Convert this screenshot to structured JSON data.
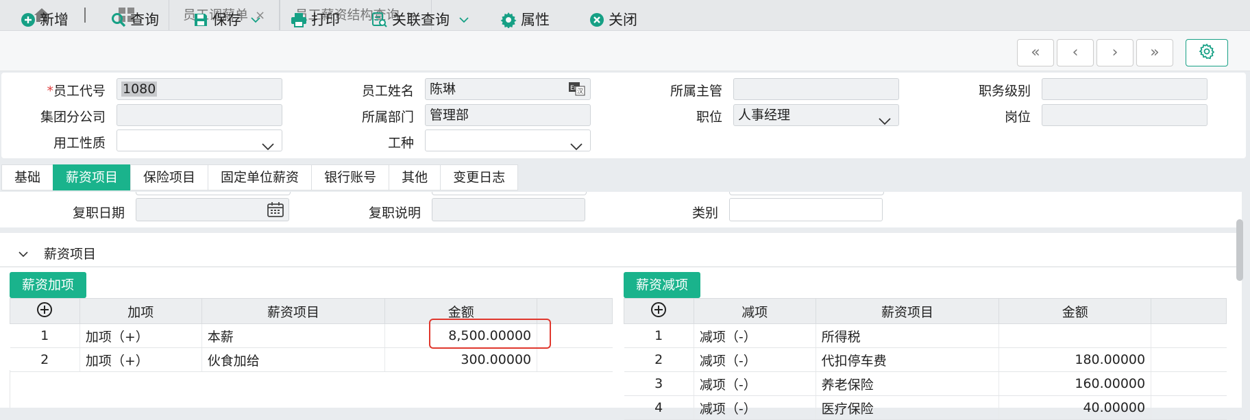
{
  "top_tabs": [
    {
      "label": "员工调薪单"
    },
    {
      "label": "员工薪资结构查询"
    }
  ],
  "tab_close": "×",
  "toolbar": {
    "add": "新增",
    "query": "查询",
    "save": "保存",
    "print": "打印",
    "related_query": "关联查询",
    "properties": "属性",
    "close": "关闭",
    "nav": {
      "first": "«",
      "prev": "‹",
      "next": "›",
      "last": "»"
    }
  },
  "form": {
    "required_mark": "*",
    "employee_code_label": "员工代号",
    "employee_code_value": "1080",
    "employee_name_label": "员工姓名",
    "employee_name_value": "陈琳",
    "supervisor_label": "所属主管",
    "supervisor_value": "",
    "job_level_label": "职务级别",
    "job_level_value": "",
    "branch_label": "集团分公司",
    "branch_value": "",
    "department_label": "所属部门",
    "department_value": "管理部",
    "position_label": "职位",
    "position_value": "人事经理",
    "post_label": "岗位",
    "post_value": "",
    "employment_type_label": "用工性质",
    "employment_type_value": "",
    "work_type_label": "工种",
    "work_type_value": ""
  },
  "record_tabs": [
    "基础",
    "薪资项目",
    "保险项目",
    "固定单位薪资",
    "银行账号",
    "其他",
    "变更日志"
  ],
  "active_tab": 1,
  "section_fields": {
    "reinstate_date_label": "复职日期",
    "reinstate_note_label": "复职说明",
    "category_label": "类别"
  },
  "salary_section_title": "薪资项目",
  "add_items": {
    "button": "薪资加项",
    "headers": [
      "加项",
      "薪资项目",
      "金额"
    ],
    "rows": [
      {
        "no": "1",
        "type": "加项（+）",
        "item": "本薪",
        "amount": "8,500.00000"
      },
      {
        "no": "2",
        "type": "加项（+）",
        "item": "伙食加给",
        "amount": "300.00000"
      }
    ]
  },
  "deduct_items": {
    "button": "薪资减项",
    "headers": [
      "减项",
      "薪资项目",
      "金额"
    ],
    "rows": [
      {
        "no": "1",
        "type": "减项（-）",
        "item": "所得税",
        "amount": ""
      },
      {
        "no": "2",
        "type": "减项（-）",
        "item": "代扣停车费",
        "amount": "180.00000"
      },
      {
        "no": "3",
        "type": "减项（-）",
        "item": "养老保险",
        "amount": "160.00000"
      },
      {
        "no": "4",
        "type": "减项（-）",
        "item": "医疗保险",
        "amount": "40.00000"
      }
    ]
  },
  "colors": {
    "accent": "#1ab38c",
    "highlight": "#e0362c"
  }
}
